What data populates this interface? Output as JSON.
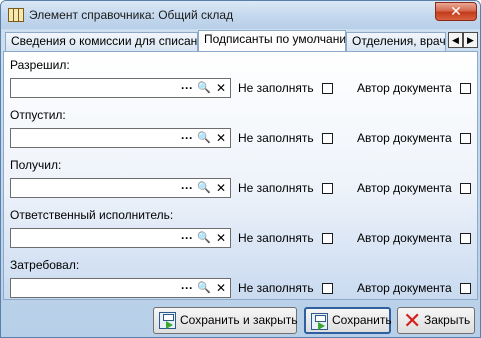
{
  "window": {
    "title": "Элемент справочника: Общий склад",
    "close_glyph": "✕"
  },
  "tabs": [
    {
      "label": "Сведения о комиссии для списания",
      "active": false
    },
    {
      "label": "Подписанты по умолчанию",
      "active": true
    },
    {
      "label": "Отделения, врачи",
      "active": false
    }
  ],
  "tab_scroll": {
    "left": "◀",
    "right": "▶"
  },
  "fields": [
    {
      "label": "Разрешил:",
      "value": "",
      "no_fill_label": "Не заполнять",
      "author_label": "Автор документа",
      "no_fill_checked": false,
      "author_checked": false
    },
    {
      "label": "Отпустил:",
      "value": "",
      "no_fill_label": "Не заполнять",
      "author_label": "Автор документа",
      "no_fill_checked": false,
      "author_checked": false
    },
    {
      "label": "Получил:",
      "value": "",
      "no_fill_label": "Не заполнять",
      "author_label": "Автор документа",
      "no_fill_checked": false,
      "author_checked": false
    },
    {
      "label": "Ответственный исполнитель:",
      "value": "",
      "no_fill_label": "Не заполнять",
      "author_label": "Автор документа",
      "no_fill_checked": false,
      "author_checked": false
    },
    {
      "label": "Затребовал:",
      "value": "",
      "no_fill_label": "Не заполнять",
      "author_label": "Автор документа",
      "no_fill_checked": false,
      "author_checked": false
    }
  ],
  "field_buttons": {
    "browse": "···",
    "search": "🔍",
    "clear": "✕"
  },
  "buttons": {
    "save_close": "Сохранить и закрыть",
    "save": "Сохранить",
    "close": "Закрыть"
  },
  "icons": {
    "save": "save-icon",
    "close": "close-icon"
  }
}
